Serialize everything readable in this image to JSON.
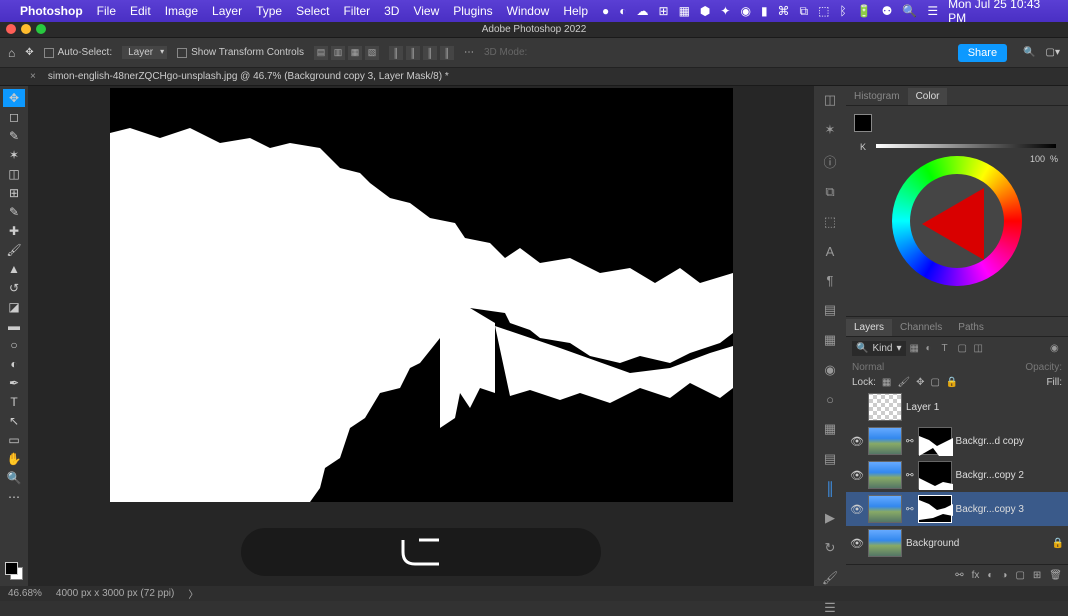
{
  "menubar": {
    "app": "Photoshop",
    "items": [
      "File",
      "Edit",
      "Image",
      "Layer",
      "Type",
      "Select",
      "Filter",
      "3D",
      "View",
      "Plugins",
      "Window",
      "Help"
    ],
    "datetime": "Mon Jul 25  10:43 PM"
  },
  "window": {
    "title": "Adobe Photoshop 2022"
  },
  "options": {
    "auto_select": "Auto-Select:",
    "layer_dd": "Layer",
    "show_transform": "Show Transform Controls",
    "mode_3d": "3D Mode:",
    "share": "Share"
  },
  "tab": {
    "label": "simon-english-48nerZQCHgo-unsplash.jpg @ 46.7% (Background copy 3, Layer Mask/8) *"
  },
  "overlay": {
    "key": "⌥"
  },
  "color": {
    "tabs": [
      "Histogram",
      "Color"
    ],
    "slider_label": "K",
    "value": "100",
    "pct": "%"
  },
  "layers": {
    "tabs": [
      "Layers",
      "Channels",
      "Paths"
    ],
    "kind": "Kind",
    "blend_mode": "Normal",
    "opacity_label": "Opacity:",
    "lock_label": "Lock:",
    "fill_label": "Fill:",
    "items": [
      {
        "name": "Layer 1",
        "eye": false,
        "mask": false,
        "selected": false
      },
      {
        "name": "Backgr...d copy",
        "eye": true,
        "mask": true,
        "selected": false
      },
      {
        "name": "Backgr...copy 2",
        "eye": true,
        "mask": true,
        "selected": false
      },
      {
        "name": "Backgr...copy 3",
        "eye": true,
        "mask": true,
        "selected": true
      },
      {
        "name": "Background",
        "eye": true,
        "mask": false,
        "selected": false,
        "locked": true
      }
    ]
  },
  "status": {
    "zoom": "46.68%",
    "dims": "4000 px x 3000 px (72 ppi)"
  }
}
